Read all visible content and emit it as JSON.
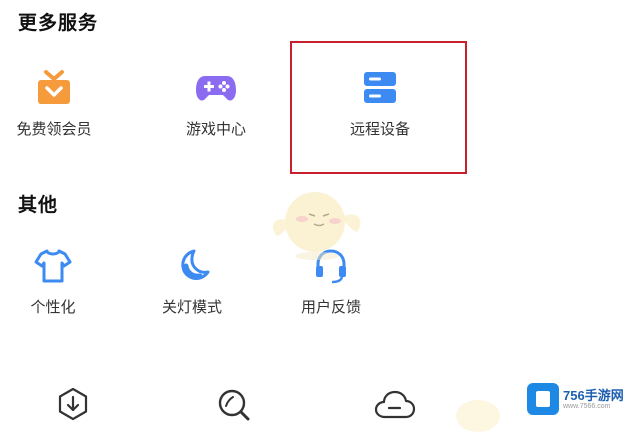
{
  "sections": {
    "more_services": {
      "title": "更多服务",
      "items": [
        {
          "label": "免费领会员",
          "icon": "gift-icon",
          "color": "#f59b3c"
        },
        {
          "label": "游戏中心",
          "icon": "gamepad-icon",
          "color": "#8b6cf0"
        },
        {
          "label": "远程设备",
          "icon": "server-icon",
          "color": "#3d8bf2"
        }
      ]
    },
    "other": {
      "title": "其他",
      "items": [
        {
          "label": "个性化",
          "icon": "tshirt-icon",
          "color": "#3d8bf2"
        },
        {
          "label": "关灯模式",
          "icon": "moon-icon",
          "color": "#3d8bf2"
        },
        {
          "label": "用户反馈",
          "icon": "headset-icon",
          "color": "#3d8bf2"
        }
      ]
    }
  },
  "bottom_nav": [
    {
      "icon": "download-icon"
    },
    {
      "icon": "search-icon"
    },
    {
      "icon": "cloud-icon"
    }
  ],
  "watermark": {
    "brand": "756手游网",
    "url": "www.7566.com"
  },
  "colors": {
    "highlight_border": "#c8202c",
    "accent_blue": "#3d8bf2"
  }
}
